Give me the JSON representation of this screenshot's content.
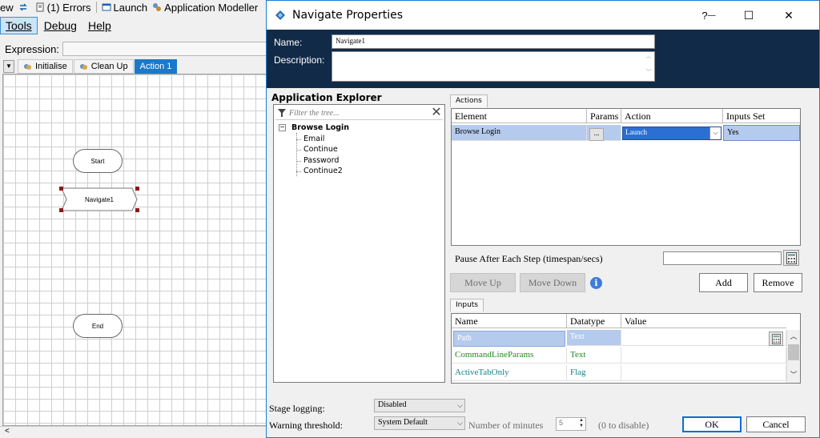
{
  "background": {
    "toolbar": {
      "view_fragment": "ew",
      "errors": "(1) Errors",
      "launch": "Launch",
      "app_modeller": "Application Modeller"
    },
    "menu": {
      "tools": "Tools",
      "debug": "Debug",
      "help": "Help"
    },
    "expression_label": "Expression:",
    "tabs": {
      "initialise": "Initialise",
      "cleanup": "Clean Up",
      "action1": "Action 1"
    },
    "stages": {
      "start": "Start",
      "navigate": "Navigate1",
      "end": "End"
    }
  },
  "dialog": {
    "title": "Navigate Properties",
    "controls": {
      "help": "?",
      "minimize": "—",
      "maximize": "☐",
      "close": "✕"
    },
    "name_label": "Name:",
    "name_value": "Navigate1",
    "description_label": "Description:",
    "description_value": "",
    "app_explorer": {
      "title": "Application Explorer",
      "filter_placeholder": "Filter the tree...",
      "root": "Browse Login",
      "children": [
        "Email",
        "Continue",
        "Password",
        "Continue2"
      ]
    },
    "actions": {
      "tab": "Actions",
      "columns": [
        "Element",
        "Params",
        "Action",
        "Inputs Set"
      ],
      "rows": [
        {
          "element": "Browse Login",
          "params": "...",
          "action": "Launch",
          "inputs_set": "Yes"
        }
      ],
      "pause_label": "Pause After Each Step (timespan/secs)",
      "pause_value": "",
      "buttons": {
        "move_up": "Move Up",
        "move_down": "Move Down",
        "add": "Add",
        "remove": "Remove"
      }
    },
    "inputs": {
      "tab": "Inputs",
      "columns": [
        "Name",
        "Datatype",
        "Value"
      ],
      "rows": [
        {
          "name": "Path",
          "datatype": "Text",
          "value": ""
        },
        {
          "name": "CommandLineParams",
          "datatype": "Text",
          "value": ""
        },
        {
          "name": "ActiveTabOnly",
          "datatype": "Flag",
          "value": ""
        }
      ]
    },
    "footer": {
      "stage_logging_label": "Stage logging:",
      "stage_logging_value": "Disabled",
      "warning_label": "Warning threshold:",
      "warning_value": "System Default",
      "minutes_label": "Number of minutes",
      "minutes_value": "5",
      "minutes_hint": "(0 to disable)",
      "ok": "OK",
      "cancel": "Cancel"
    }
  },
  "colors": {
    "header_bg": "#112a48",
    "accent": "#1c78c8",
    "selection": "#b5cbed",
    "input_name_green": "#1f8a1f",
    "input_name_teal": "#14808a"
  }
}
